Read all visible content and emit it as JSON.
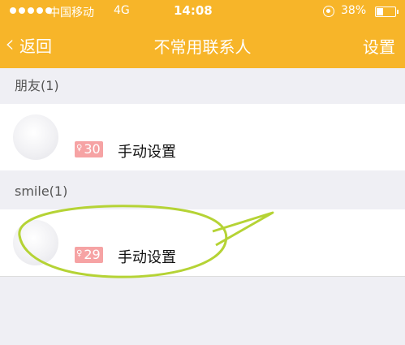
{
  "status_bar": {
    "carrier": "中国移动",
    "network": "4G",
    "time": "14:08",
    "battery": "38%"
  },
  "nav": {
    "back_label": "返回",
    "title": "不常用联系人",
    "settings_label": "设置"
  },
  "groups": [
    {
      "header": "朋友(1)",
      "contact": {
        "name": "",
        "badge_value": "30",
        "action_label": "手动设置"
      }
    },
    {
      "header": "smile(1)",
      "contact": {
        "name": "",
        "badge_value": "29",
        "action_label": "手动设置"
      }
    }
  ],
  "colors": {
    "nav_background": "#f7b529",
    "badge_background": "#f6a3a4",
    "annotation_stroke": "#b5d335",
    "page_background": "#efeff4"
  }
}
